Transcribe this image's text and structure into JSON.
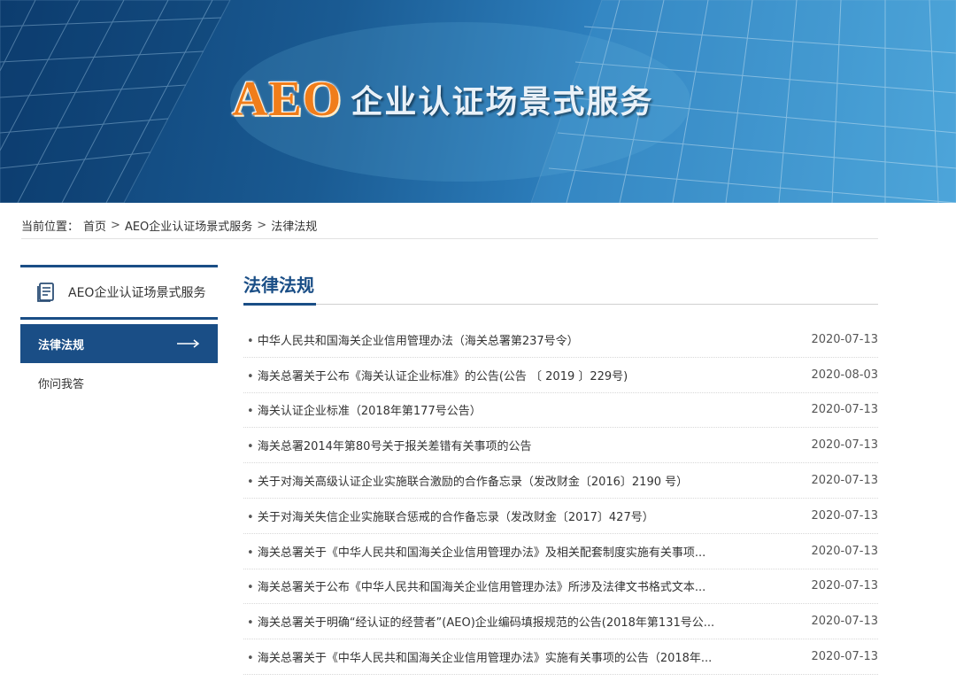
{
  "banner": {
    "brand": "AEO",
    "title": "企业认证场景式服务"
  },
  "breadcrumb": {
    "prefix": "当前位置：",
    "items": [
      "首页",
      "AEO企业认证场景式服务",
      "法律法规"
    ],
    "separator": ">"
  },
  "sidebar": {
    "title": "AEO企业认证场景式服务",
    "icon": "document-icon",
    "items": [
      {
        "label": "法律法规",
        "active": true
      },
      {
        "label": "你问我答",
        "active": false
      }
    ]
  },
  "main": {
    "title": "法律法规",
    "rows": [
      {
        "title": "中华人民共和国海关企业信用管理办法（海关总署第237号令）",
        "date": "2020-07-13"
      },
      {
        "title": "海关总署关于公布《海关认证企业标准》的公告(公告 〔 2019 〕229号)",
        "date": "2020-08-03"
      },
      {
        "title": "海关认证企业标准（2018年第177号公告）",
        "date": "2020-07-13"
      },
      {
        "title": "海关总署2014年第80号关于报关差错有关事项的公告",
        "date": "2020-07-13"
      },
      {
        "title": "关于对海关高级认证企业实施联合激励的合作备忘录（发改财金〔2016〕2190 号）",
        "date": "2020-07-13"
      },
      {
        "title": "关于对海关失信企业实施联合惩戒的合作备忘录（发改财金〔2017〕427号）",
        "date": "2020-07-13"
      },
      {
        "title": "海关总署关于《中华人民共和国海关企业信用管理办法》及相关配套制度实施有关事项...",
        "date": "2020-07-13"
      },
      {
        "title": "海关总署关于公布《中华人民共和国海关企业信用管理办法》所涉及法律文书格式文本...",
        "date": "2020-07-13"
      },
      {
        "title": "海关总署关于明确“经认证的经营者”(AEO)企业编码填报规范的公告(2018年第131号公...",
        "date": "2020-07-13"
      },
      {
        "title": "海关总署关于《中华人民共和国海关企业信用管理办法》实施有关事项的公告（2018年...",
        "date": "2020-07-13"
      }
    ]
  },
  "colors": {
    "accent": "#1a4e86",
    "brand_orange": "#f07d1a"
  }
}
